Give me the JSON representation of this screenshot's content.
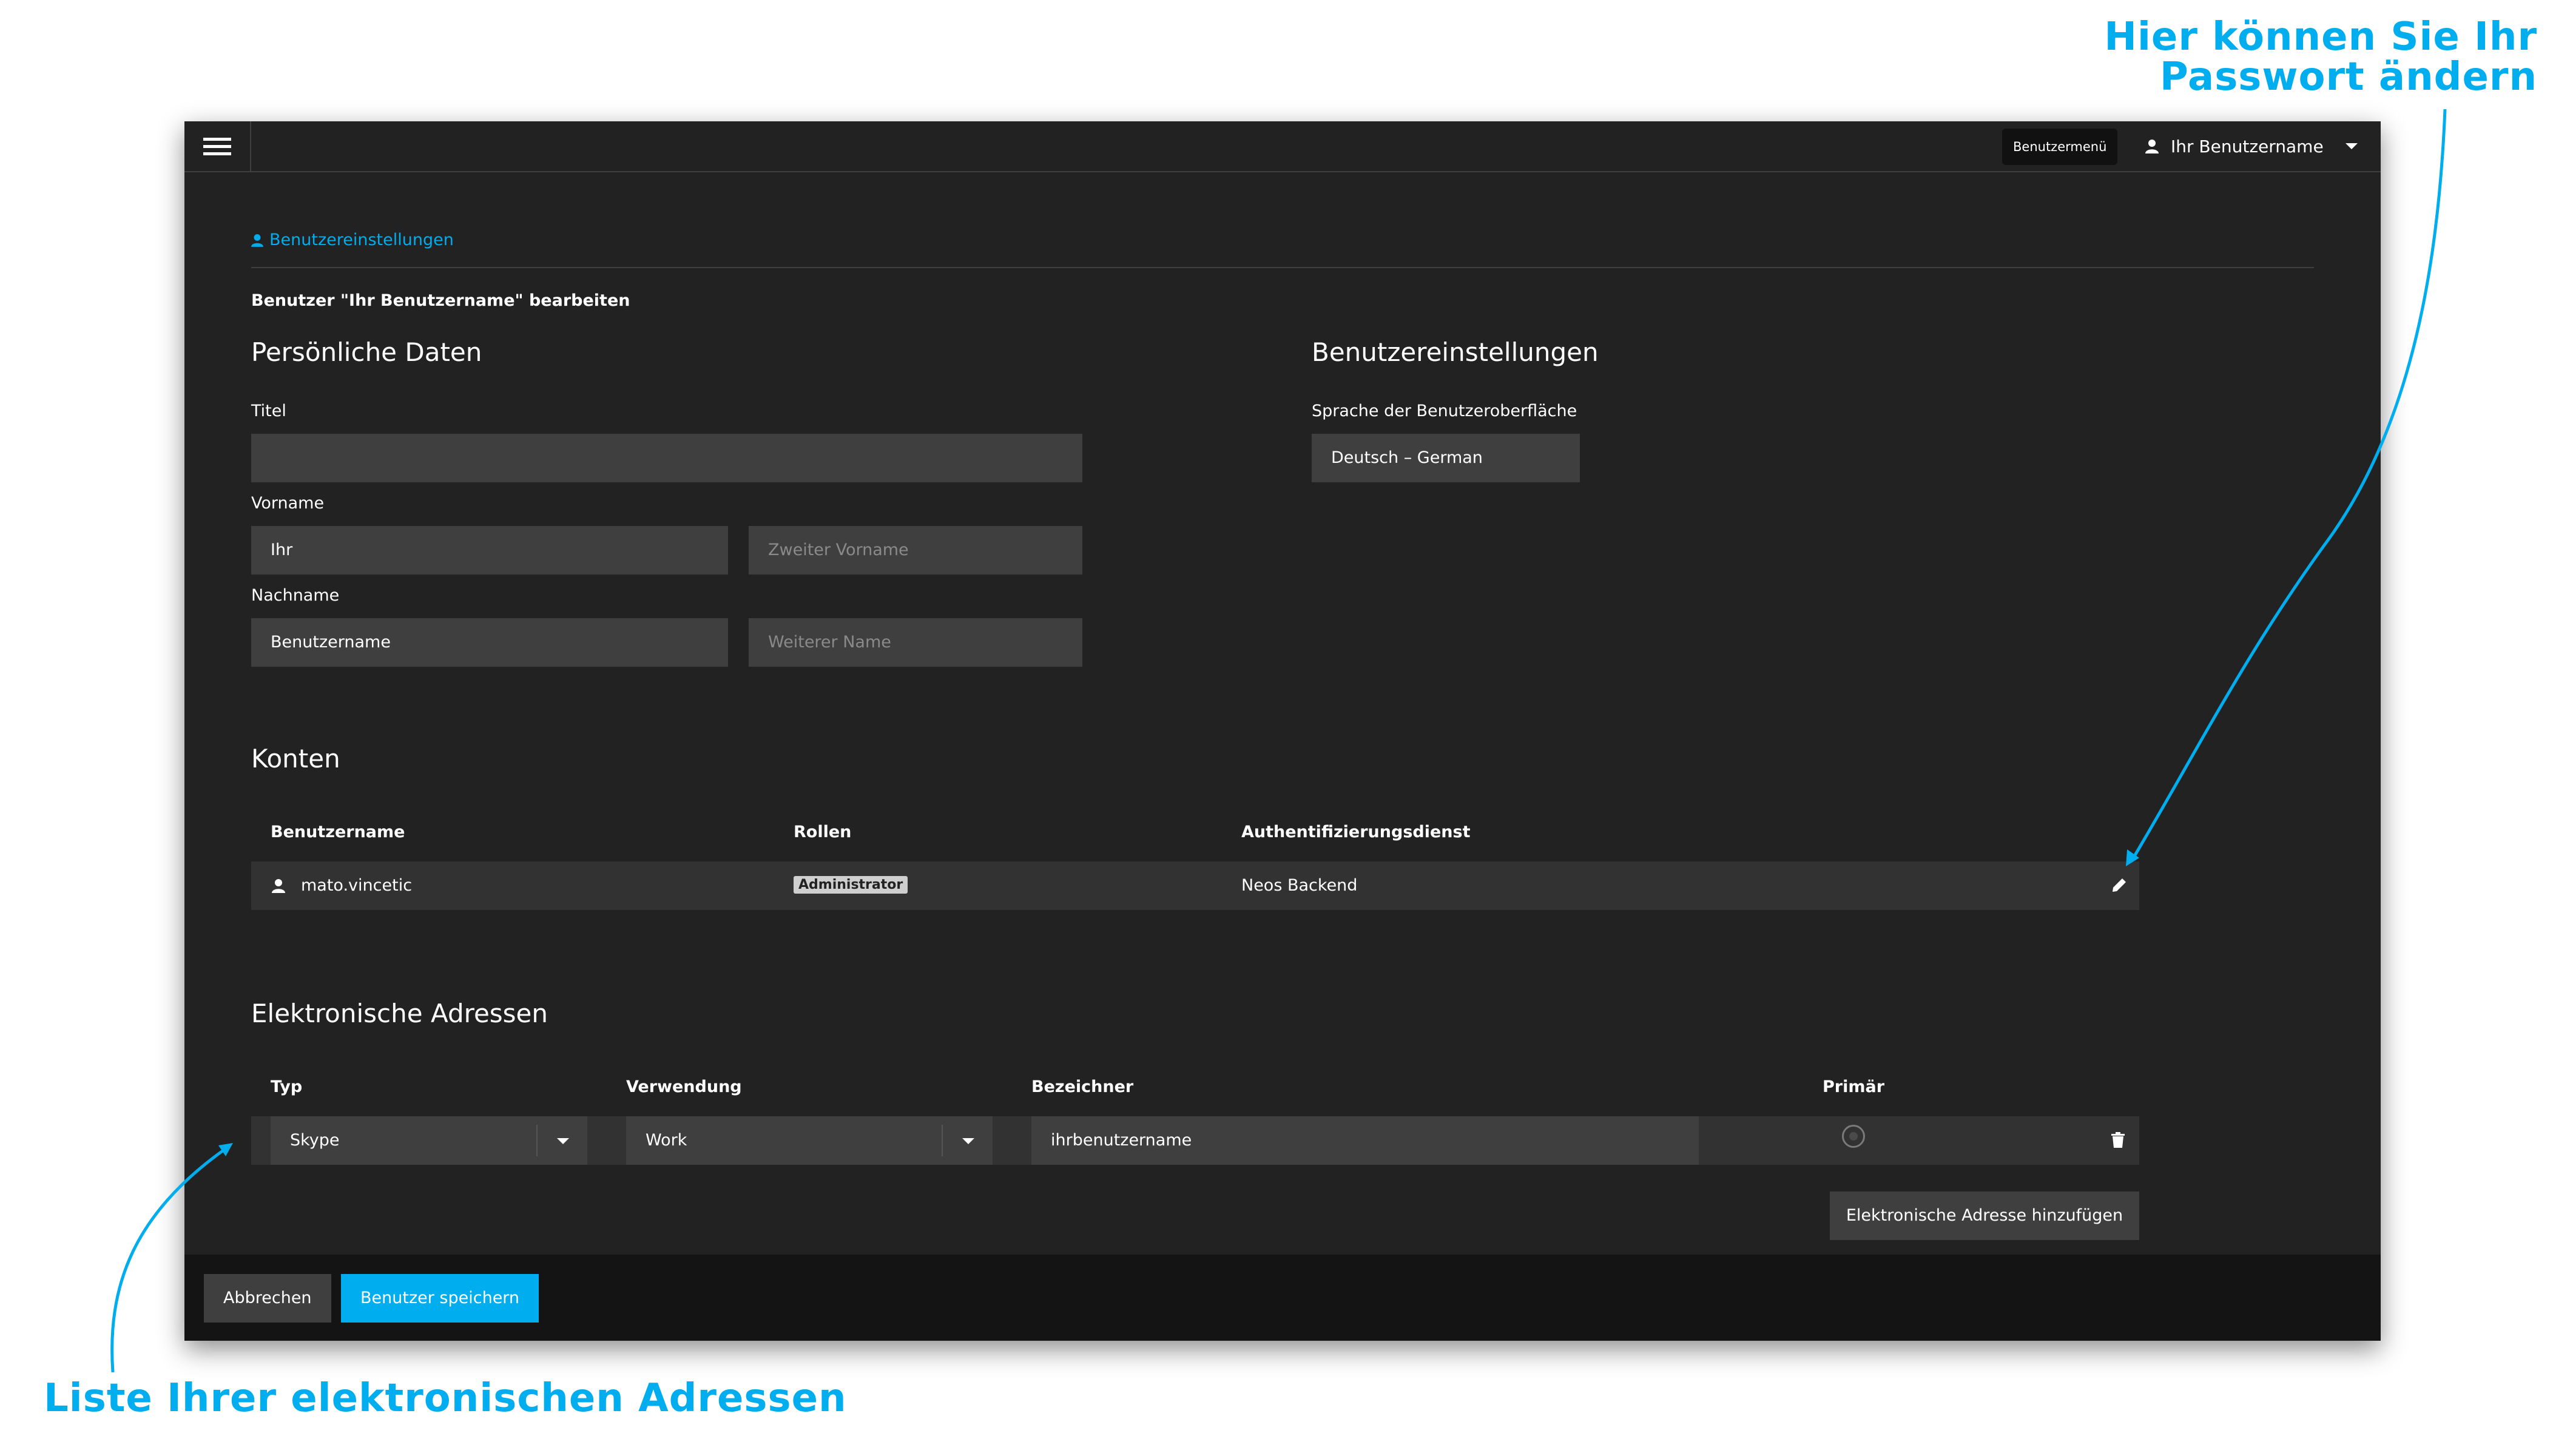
{
  "callouts": {
    "password_line1": "Hier können Sie Ihr",
    "password_line2": "Passwort ändern",
    "addresses": "Liste Ihrer elektronischen Adressen"
  },
  "colors": {
    "accent": "#00adee",
    "background": "#222222",
    "field": "#3f3f3f",
    "row": "#323232",
    "footer": "#141414"
  },
  "topbar": {
    "menu_icon": "hamburger-icon",
    "tooltip": "Benutzermenü",
    "user_icon": "user-icon",
    "user_name": "Ihr Benutzername"
  },
  "breadcrumb": {
    "icon": "user-icon",
    "label": "Benutzereinstellungen"
  },
  "edit_title": "Benutzer \"Ihr Benutzername\" bearbeiten",
  "personal": {
    "heading": "Persönliche Daten",
    "title_label": "Titel",
    "title_value": "",
    "firstname_label": "Vorname",
    "firstname_value": "Ihr",
    "middlename_placeholder": "Zweiter Vorname",
    "lastname_label": "Nachname",
    "lastname_value": "Benutzername",
    "othername_placeholder": "Weiterer Name"
  },
  "settings": {
    "heading": "Benutzereinstellungen",
    "language_label": "Sprache der Benutzeroberfläche",
    "language_value": "Deutsch – German"
  },
  "accounts": {
    "heading": "Konten",
    "columns": [
      "Benutzername",
      "Rollen",
      "Authentifizierungsdienst"
    ],
    "rows": [
      {
        "username": "mato.vincetic",
        "role": "Administrator",
        "auth": "Neos Backend",
        "edit_icon": "pencil-icon"
      }
    ]
  },
  "addresses": {
    "heading": "Elektronische Adressen",
    "columns": [
      "Typ",
      "Verwendung",
      "Bezeichner",
      "Primär"
    ],
    "rows": [
      {
        "type": "Skype",
        "usage": "Work",
        "identifier": "ihrbenutzername",
        "primary": false,
        "delete_icon": "trash-icon"
      }
    ],
    "add_button": "Elektronische Adresse hinzufügen"
  },
  "footer": {
    "cancel": "Abbrechen",
    "save": "Benutzer speichern"
  }
}
